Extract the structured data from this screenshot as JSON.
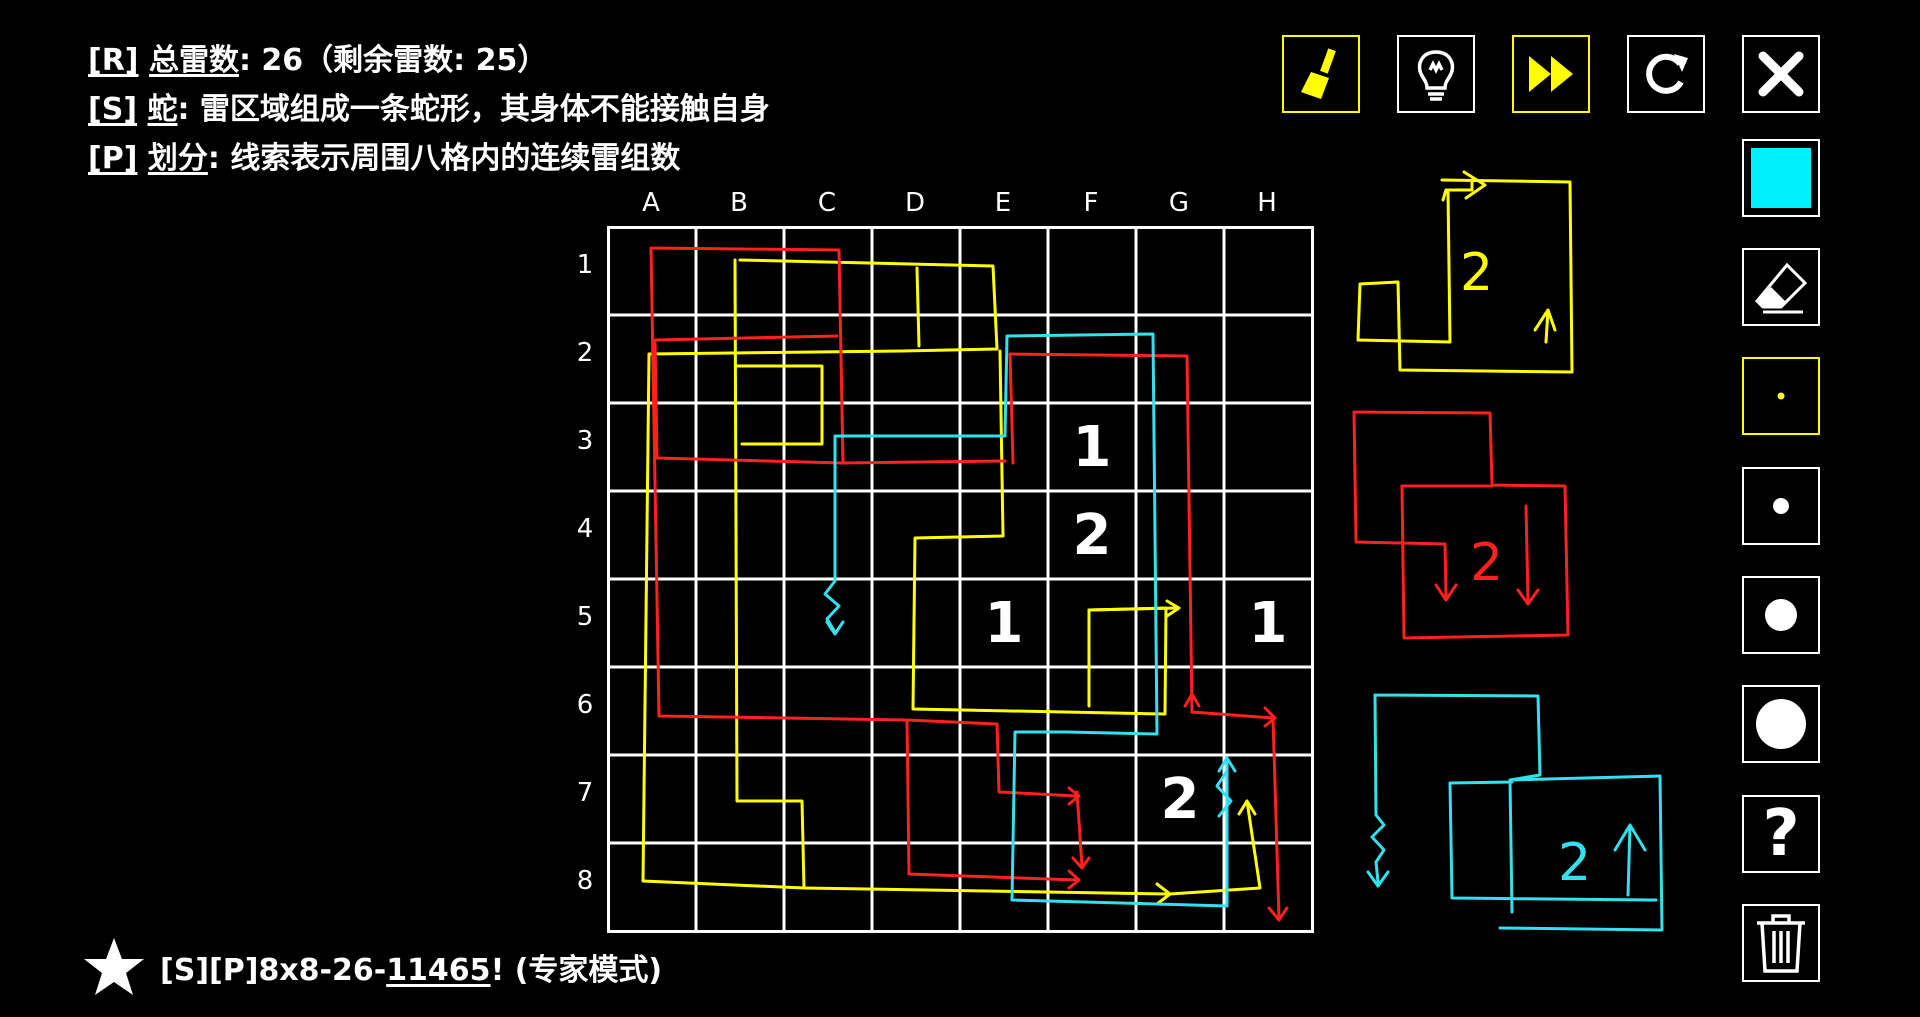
{
  "rules": [
    {
      "key": "[R]",
      "name": "总雷数",
      "text": ": 26（剩余雷数: 25）"
    },
    {
      "key": "[S]",
      "name": "蛇",
      "text": ": 雷区域组成一条蛇形，其身体不能接触自身"
    },
    {
      "key": "[P]",
      "name": "划分",
      "text": ": 线索表示周围八格内的连续雷组数"
    }
  ],
  "board": {
    "cols": [
      "A",
      "B",
      "C",
      "D",
      "E",
      "F",
      "G",
      "H"
    ],
    "rows": [
      "1",
      "2",
      "3",
      "4",
      "5",
      "6",
      "7",
      "8"
    ],
    "clues": [
      {
        "col": 5,
        "row": 2,
        "value": "1"
      },
      {
        "col": 5,
        "row": 3,
        "value": "2"
      },
      {
        "col": 4,
        "row": 4,
        "value": "1"
      },
      {
        "col": 7,
        "row": 4,
        "value": "1"
      },
      {
        "col": 6,
        "row": 6,
        "value": "2"
      }
    ],
    "grid_color": "#ffffff"
  },
  "annotation_colors": {
    "yellow": "#ffff00",
    "red": "#ff2020",
    "cyan": "#33e0ee"
  },
  "side_sketch_labels": {
    "yellow": "2",
    "red": "2",
    "cyan": "2"
  },
  "tools": {
    "top": [
      {
        "name": "brush-icon",
        "style": "yellow"
      },
      {
        "name": "lightbulb-icon",
        "style": "white"
      },
      {
        "name": "fast-forward-icon",
        "style": "yellow"
      },
      {
        "name": "restart-icon",
        "style": "white"
      },
      {
        "name": "close-icon",
        "style": "white"
      }
    ],
    "side": [
      {
        "name": "cyan-fill-icon"
      },
      {
        "name": "eraser-icon"
      },
      {
        "name": "tiny-dot-icon"
      },
      {
        "name": "small-dot-icon"
      },
      {
        "name": "medium-dot-icon"
      },
      {
        "name": "large-dot-icon"
      },
      {
        "name": "question-mark-icon",
        "label": "?"
      },
      {
        "name": "trash-icon"
      }
    ]
  },
  "footer": {
    "prefix": "[S][P]8x8-26-",
    "id": "11465",
    "suffix": "! (专家模式)"
  }
}
